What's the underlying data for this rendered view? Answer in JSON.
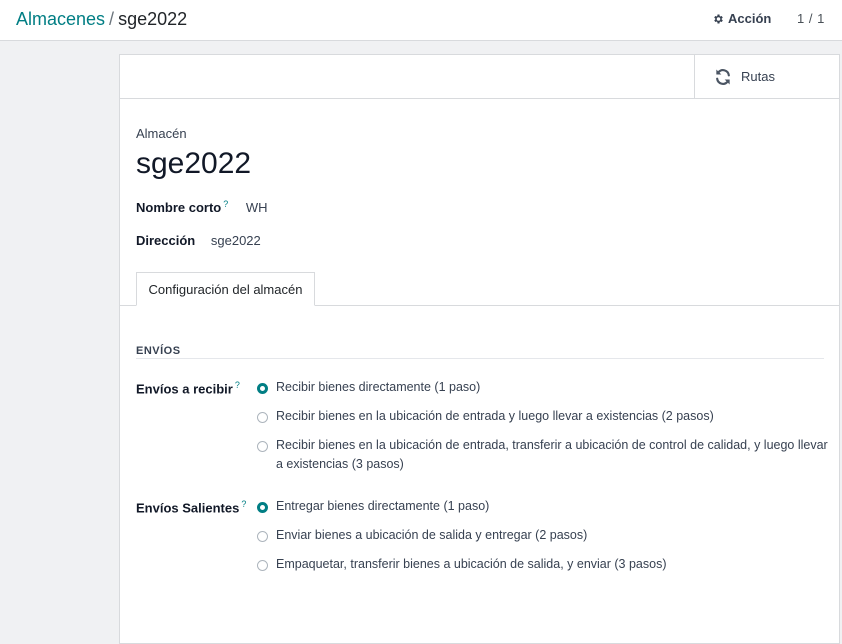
{
  "breadcrumb": {
    "parent": "Almacenes",
    "separator": "/",
    "current": "sge2022"
  },
  "toolbar": {
    "action_icon": "gear-icon",
    "action_label": "Acción",
    "pager": "1 / 1"
  },
  "stat_button": {
    "icon": "refresh-icon",
    "label": "Rutas"
  },
  "record": {
    "caption": "Almacén",
    "name": "sge2022",
    "short_name_label": "Nombre corto",
    "short_name_value": "WH",
    "address_label": "Dirección",
    "address_value": "sge2022",
    "help_marker": "?"
  },
  "tabs": [
    {
      "label": "Configuración del almacén",
      "active": true
    }
  ],
  "shipments": {
    "section_title": "ENVÍOS",
    "incoming": {
      "label": "Envíos a recibir",
      "options": [
        {
          "label": "Recibir bienes directamente (1 paso)",
          "checked": true
        },
        {
          "label": "Recibir bienes en la ubicación de entrada y luego llevar a existencias (2 pasos)",
          "checked": false
        },
        {
          "label": "Recibir bienes en la ubicación de entrada, transferir a ubicación de control de calidad, y luego llevar a existencias (3 pasos)",
          "checked": false
        }
      ]
    },
    "outgoing": {
      "label": "Envíos Salientes",
      "options": [
        {
          "label": "Entregar bienes directamente (1 paso)",
          "checked": true
        },
        {
          "label": "Enviar bienes a ubicación de salida y entregar (2 pasos)",
          "checked": false
        },
        {
          "label": "Empaquetar, transferir bienes a ubicación de salida, y enviar (3 pasos)",
          "checked": false
        }
      ]
    }
  },
  "colors": {
    "accent": "#017e84",
    "border": "#d8dadd",
    "background": "#f0f1f3"
  }
}
